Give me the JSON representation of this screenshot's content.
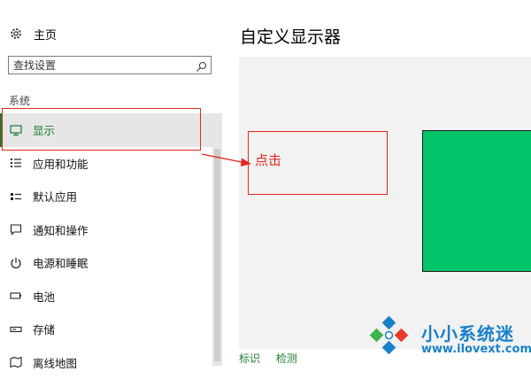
{
  "sidebar": {
    "home_label": "主页",
    "search_placeholder": "查找设置",
    "section_label": "系统",
    "items": [
      {
        "label": "显示",
        "icon": "monitor-icon",
        "active": true
      },
      {
        "label": "应用和功能",
        "icon": "app-list-icon"
      },
      {
        "label": "默认应用",
        "icon": "default-apps-icon"
      },
      {
        "label": "通知和操作",
        "icon": "notification-icon"
      },
      {
        "label": "电源和睡眠",
        "icon": "power-icon"
      },
      {
        "label": "电池",
        "icon": "battery-icon"
      },
      {
        "label": "存储",
        "icon": "storage-icon"
      },
      {
        "label": "离线地图",
        "icon": "map-icon"
      }
    ]
  },
  "main": {
    "title": "自定义显示器",
    "links": [
      "标识",
      "检测"
    ]
  },
  "annotation": {
    "text": "点击",
    "color": "#e0281e"
  },
  "watermark": {
    "title": "小小系统迷",
    "url": "www.ilovext.com"
  },
  "colors": {
    "accent": "#1c7c2f",
    "monitor": "#00c468",
    "panel": "#f2f2f2",
    "brand": "#1a80c8"
  }
}
